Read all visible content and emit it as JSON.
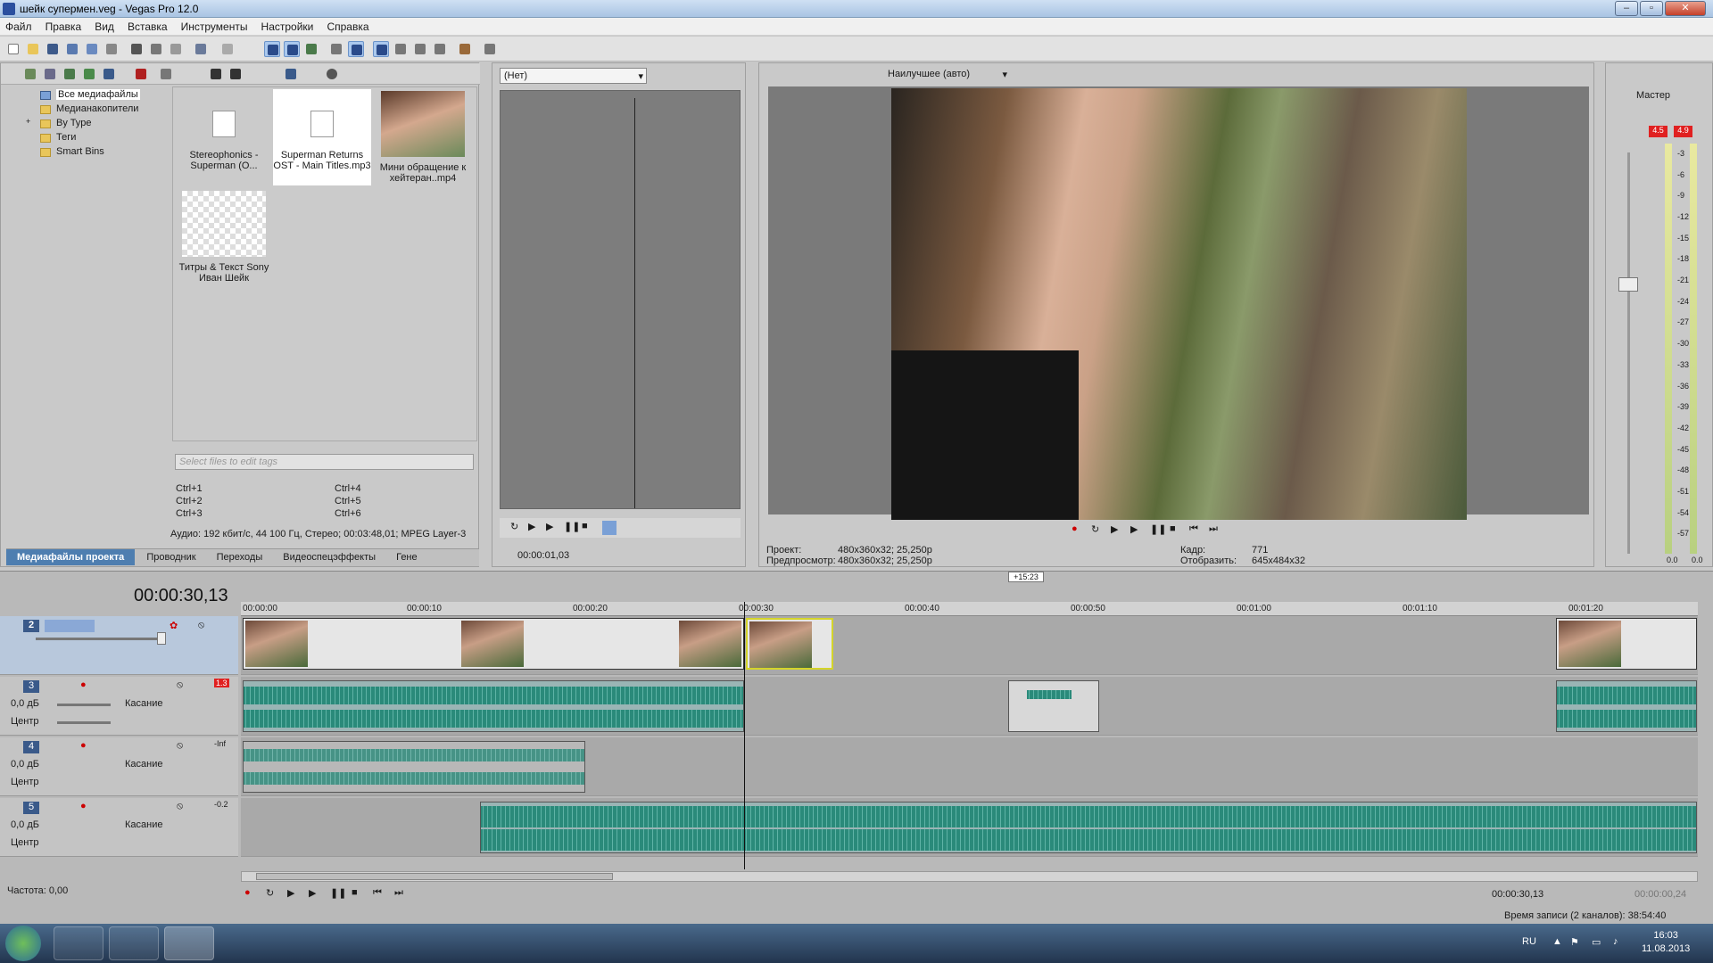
{
  "window": {
    "title": "шейк супермен.veg - Vegas Pro 12.0"
  },
  "menu": [
    "Файл",
    "Правка",
    "Вид",
    "Вставка",
    "Инструменты",
    "Настройки",
    "Справка"
  ],
  "explorer": {
    "tree": [
      "Все медиафайлы",
      "Медианакопители",
      "By Type",
      "Теги",
      "Smart Bins"
    ],
    "media": [
      {
        "label": "Stereophonics - Superman (O..."
      },
      {
        "label": "Superman Returns OST - Main Titles.mp3"
      },
      {
        "label": "Мини обращение к хейтеран..mp4"
      },
      {
        "label": "Титры & Текст Sony Иван Шейк"
      }
    ],
    "tags_placeholder": "Select files to edit tags",
    "shortcuts_left": [
      "Ctrl+1",
      "Ctrl+2",
      "Ctrl+3"
    ],
    "shortcuts_right": [
      "Ctrl+4",
      "Ctrl+5",
      "Ctrl+6"
    ],
    "file_info": "Аудио: 192 кбит/с, 44 100 Гц, Стерео; 00:03:48,01; MPEG Layer-3",
    "tabs": [
      "Медиафайлы проекта",
      "Проводник",
      "Переходы",
      "Видеоспецэффекты",
      "Гене"
    ]
  },
  "trimmer": {
    "dropdown": "(Нет)",
    "timecode": "00:00:01,03"
  },
  "preview": {
    "quality": "Наилучшее (авто)",
    "project_label": "Проект:",
    "project_value": "480x360x32; 25,250р",
    "preview_label": "Предпросмотр:",
    "preview_value": "480x360x32; 25,250р",
    "frame_label": "Кадр:",
    "frame_value": "771",
    "display_label": "Отобразить:",
    "display_value": "645x484x32"
  },
  "master": {
    "label": "Мастер",
    "peak_left": "4.5",
    "peak_right": "4.9",
    "scale": [
      "3",
      "6",
      "9",
      "12",
      "15",
      "18",
      "21",
      "24",
      "27",
      "30",
      "33",
      "36",
      "39",
      "42",
      "45",
      "48",
      "51",
      "54",
      "57"
    ],
    "bottom_left": "0.0",
    "bottom_right": "0.0"
  },
  "timeline": {
    "timecode": "00:00:30,13",
    "marker": "+15:23",
    "ruler": [
      "00:00:00",
      "00:00:10",
      "00:00:20",
      "00:00:30",
      "00:00:40",
      "00:00:50",
      "00:01:00",
      "00:01:10",
      "00:01:20"
    ],
    "tracks": [
      {
        "num": "2",
        "type": "video"
      },
      {
        "num": "3",
        "type": "audio",
        "vol": "0,0 дБ",
        "pan": "Центр",
        "mode": "Касание",
        "peak": "1.3"
      },
      {
        "num": "4",
        "type": "audio",
        "vol": "0,0 дБ",
        "pan": "Центр",
        "mode": "Касание",
        "peak": "-Inf"
      },
      {
        "num": "5",
        "type": "audio",
        "vol": "0,0 дБ",
        "pan": "Центр",
        "mode": "Касание",
        "peak": "-0.2"
      }
    ],
    "rate_label": "Частота: 0,00",
    "cursor_time": "00:00:30,13",
    "end_time": "00:00:00,24",
    "status": "Время записи (2 каналов): 38:54:40"
  },
  "taskbar": {
    "lang": "RU",
    "time": "16:03",
    "date": "11.08.2013"
  },
  "colors": {
    "accent": "#aac8ee",
    "waveform": "#2a8a7a",
    "peak": "#e02020"
  }
}
